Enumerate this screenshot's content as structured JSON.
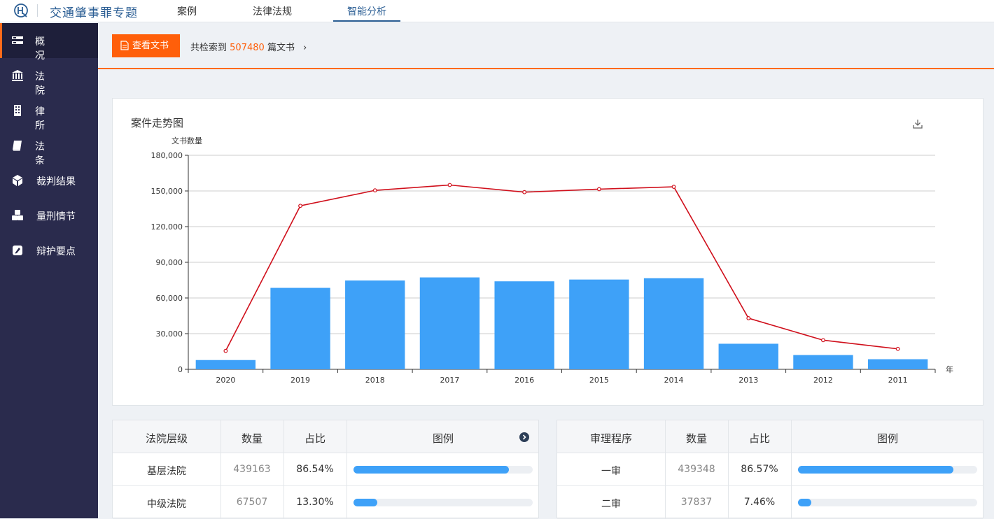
{
  "app": {
    "title": "交通肇事罪专题",
    "tabs": [
      "案例",
      "法律法规",
      "智能分析"
    ],
    "active_tab": "智能分析"
  },
  "sidebar": {
    "items": [
      {
        "label": "概况",
        "icon": "overview-icon",
        "active": true
      },
      {
        "label": "法院",
        "icon": "court-icon"
      },
      {
        "label": "律所",
        "icon": "building-icon"
      },
      {
        "label": "法条",
        "icon": "book-icon"
      },
      {
        "label": "裁判结果",
        "icon": "cube-icon"
      },
      {
        "label": "量刑情节",
        "icon": "cubes-icon"
      },
      {
        "label": "辩护要点",
        "icon": "edit-icon"
      }
    ]
  },
  "header": {
    "view_button": "查看文书",
    "count_prefix": "共检索到",
    "count_value": "507480",
    "count_suffix": "篇文书",
    "count_arrow": "›"
  },
  "colors": {
    "accent": "#ff5f0a",
    "sidebar": "#2a2b4d",
    "bar": "#3ea1f8",
    "line": "#d0101c",
    "brand": "#2b5e94"
  },
  "chart_data": {
    "type": "bar",
    "title": "案件走势图",
    "ylabel": "文书数量",
    "xlabel": "年",
    "categories": [
      "2020",
      "2019",
      "2018",
      "2017",
      "2016",
      "2015",
      "2014",
      "2013",
      "2012",
      "2011"
    ],
    "y_ticks": [
      "180,000",
      "150,000",
      "120,000",
      "90,000",
      "60,000",
      "30,000",
      "0"
    ],
    "ylim": [
      0,
      180000
    ],
    "grid": true,
    "series": [
      {
        "type": "bar",
        "values": [
          7800,
          68500,
          74700,
          77300,
          74000,
          75500,
          76600,
          21500,
          12000,
          8500
        ]
      },
      {
        "type": "line",
        "values": [
          15500,
          137500,
          150500,
          155000,
          149000,
          151500,
          153500,
          43000,
          24500,
          17200
        ]
      }
    ]
  },
  "court_table": {
    "headers": [
      "法院层级",
      "数量",
      "占比",
      "图例"
    ],
    "rows": [
      {
        "name": "基层法院",
        "count": "439163",
        "percent": "86.54%",
        "ratio": 0.8654
      },
      {
        "name": "中级法院",
        "count": "67507",
        "percent": "13.30%",
        "ratio": 0.133
      }
    ]
  },
  "trial_table": {
    "headers": [
      "审理程序",
      "数量",
      "占比",
      "图例"
    ],
    "rows": [
      {
        "name": "一审",
        "count": "439348",
        "percent": "86.57%",
        "ratio": 0.8657
      },
      {
        "name": "二审",
        "count": "37837",
        "percent": "7.46%",
        "ratio": 0.0746
      }
    ]
  }
}
